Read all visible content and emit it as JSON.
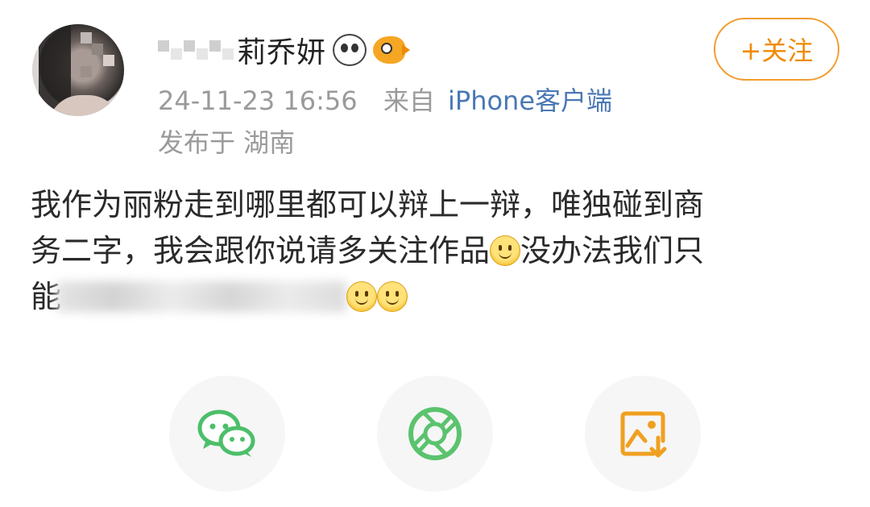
{
  "user": {
    "name_visible": "莉乔妍",
    "badges": [
      "panda-badge-icon",
      "fish-badge-icon"
    ]
  },
  "follow_button": {
    "label": "+关注"
  },
  "meta": {
    "timestamp": "24-11-23 16:56",
    "from_label": "来自",
    "client": "iPhone客户端",
    "location": "发布于 湖南"
  },
  "post": {
    "line1": "我作为丽粉走到哪里都可以辩上一辩，唯独碰到商",
    "line2": "务二字，我会跟你说请多关注作品",
    "line2_tail": "没办法我们只",
    "line3": "能"
  },
  "share_actions": [
    {
      "icon": "wechat-icon"
    },
    {
      "icon": "moments-icon"
    },
    {
      "icon": "save-image-icon"
    }
  ],
  "colors": {
    "accent": "#f08a00",
    "link": "#4a78b4",
    "meta": "#9a9a9a",
    "wechat": "#4cbf6a",
    "moments": "#5bc36e"
  }
}
